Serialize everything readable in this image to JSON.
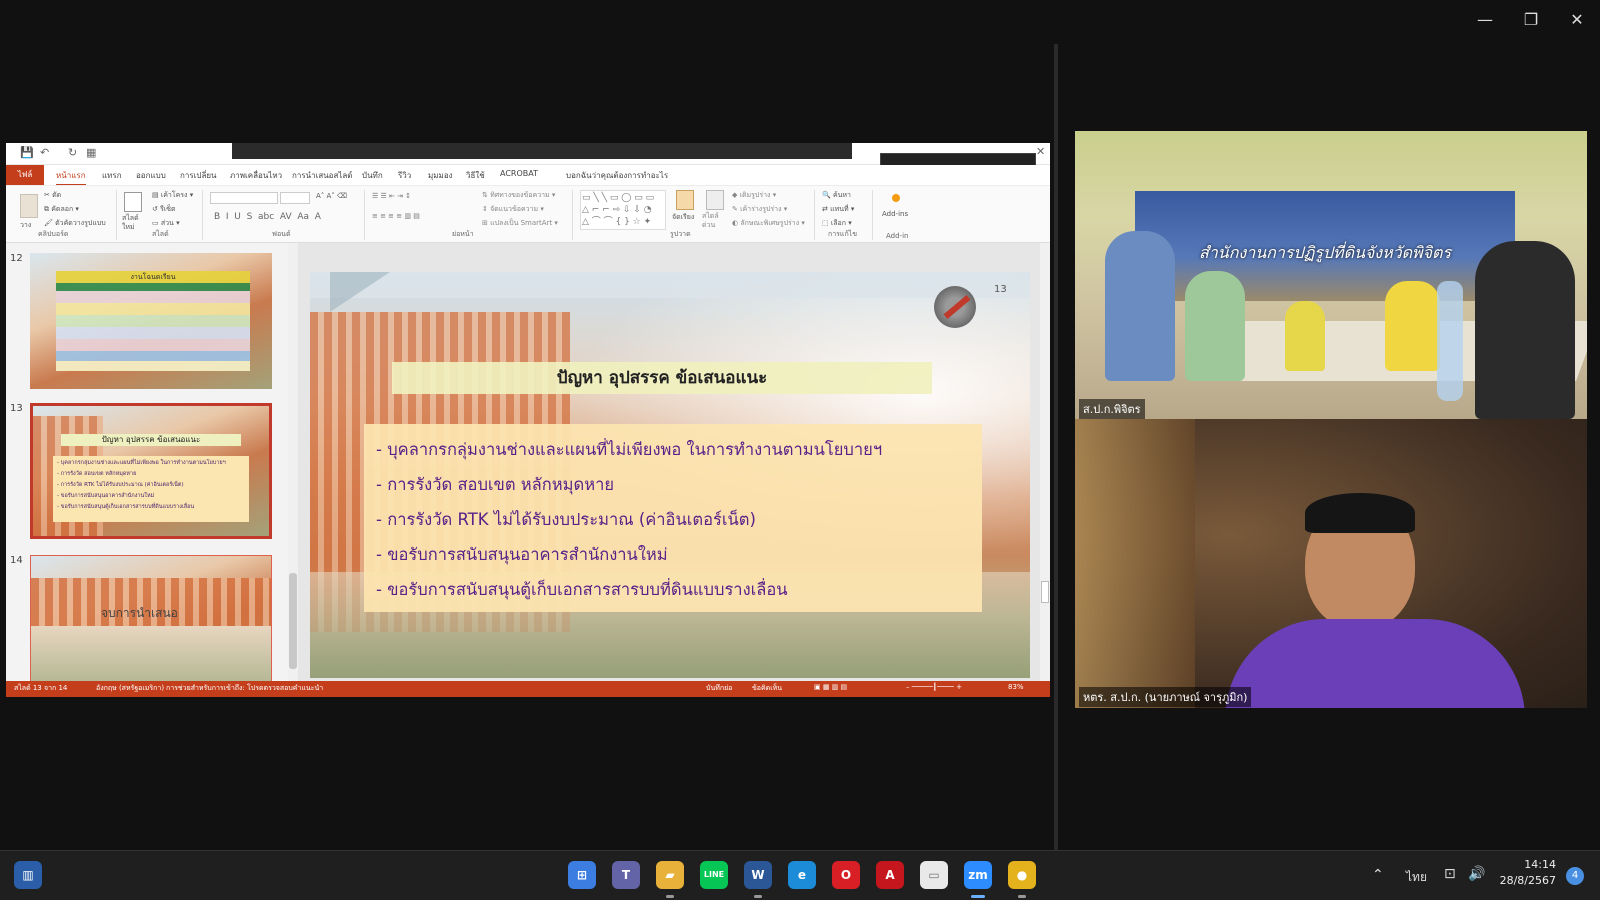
{
  "window": {
    "minimize": "—",
    "restore": "❐",
    "close": "✕"
  },
  "ppt": {
    "title_overlay": "",
    "tabs": [
      {
        "label": "ไฟล์",
        "cls": "file"
      },
      {
        "label": "หน้าแรก",
        "cls": "active"
      },
      {
        "label": "แทรก"
      },
      {
        "label": "ออกแบบ"
      },
      {
        "label": "การเปลี่ยน"
      },
      {
        "label": "ภาพเคลื่อนไหว"
      },
      {
        "label": "การนำเสนอสไลด์"
      },
      {
        "label": "บันทึก"
      },
      {
        "label": "รีวิว"
      },
      {
        "label": "มุมมอง"
      },
      {
        "label": "วิธีใช้"
      },
      {
        "label": "ACROBAT"
      },
      {
        "label": "บอกฉันว่าคุณต้องการทำอะไร"
      }
    ],
    "ribbon": {
      "clipboard": {
        "cut": "ตัด",
        "copy": "คัดลอก",
        "format_painter": "ตัวคัดวางรูปแบบ",
        "paste": "วาง",
        "group": "คลิปบอร์ด"
      },
      "slides": {
        "new_slide": "สไลด์ใหม่",
        "layout": "เค้าโครง",
        "reset": "รีเซ็ต",
        "section": "ส่วน",
        "group": "สไลด์"
      },
      "font": {
        "group": "ฟอนต์"
      },
      "paragraph": {
        "text_direction": "ทิศทางของข้อความ",
        "align_text": "จัดแนวข้อความ",
        "smartart": "แปลงเป็น SmartArt",
        "group": "ย่อหน้า"
      },
      "drawing": {
        "arrange": "จัดเรียง",
        "quick_styles": "สไตล์ด่วน",
        "shape_fill": "เติมรูปร่าง",
        "shape_outline": "เค้าร่างรูปร่าง",
        "shape_effects": "ลักษณะพิเศษรูปร่าง",
        "group": "รูปวาด"
      },
      "editing": {
        "find": "ค้นหา",
        "replace": "แทนที่",
        "select": "เลือก",
        "group": "การแก้ไข"
      },
      "addins": {
        "label": "Add-ins",
        "group": "Add-in"
      }
    },
    "thumbnails": [
      {
        "num": "12",
        "title": "งานโฉนดเรียน"
      },
      {
        "num": "13",
        "title": "ปัญหา อุปสรรค ข้อเสนอแนะ",
        "bullets": [
          "- บุคลากรกลุ่มงานช่างและแผนที่ไม่เพียงพอ ในการทำงานตามนโยบายฯ",
          "- การรังวัด สอบเขต หลักหมุดหาย",
          "- การรังวัด RTK ไม่ได้รับงบประมาณ (ค่าอินเตอร์เน็ต)",
          "- ขอรับการสนับสนุนอาคารสำนักงานใหม่",
          "- ขอรับการสนับสนุนตู้เก็บเอกสารสารบบที่ดินแบบรางเลื่อน"
        ]
      },
      {
        "num": "14",
        "title": "จบการนำเสนอ"
      }
    ],
    "slide": {
      "number": "13",
      "title": "ปัญหา อุปสรรค ข้อเสนอแนะ",
      "bullets": [
        "- บุคลากรกลุ่มงานช่างและแผนที่ไม่เพียงพอ ในการทำงานตามนโยบายฯ",
        "- การรังวัด สอบเขต หลักหมุดหาย",
        "- การรังวัด RTK ไม่ได้รับงบประมาณ (ค่าอินเตอร์เน็ต)",
        "- ขอรับการสนับสนุนอาคารสำนักงานใหม่",
        "- ขอรับการสนับสนุนตู้เก็บเอกสารสารบบที่ดินแบบรางเลื่อน"
      ]
    },
    "status": {
      "slide_count": "สไลด์ 13 จาก 14",
      "language": "อังกฤษ (สหรัฐอเมริกา)",
      "accessibility": "การช่วยสำหรับการเข้าถึง: โปรดตรวจสอบคำแนะนำ",
      "notes": "บันทึกย่อ",
      "comments": "ข้อคิดเห็น",
      "zoom": "83%"
    }
  },
  "video": {
    "tile1_name": "ส.ป.ก.พิจิตร",
    "banner": "สำนักงานการปฏิรูปที่ดินจังหวัดพิจิตร",
    "tile2_name": "หตร. ส.ป.ก. (นายภาษณ์ จารุภูมิก)"
  },
  "taskbar": {
    "apps": [
      {
        "name": "start-button",
        "label": "⊞",
        "color": "#3b7de0"
      },
      {
        "name": "teams-icon",
        "label": "T",
        "color": "#6264a7"
      },
      {
        "name": "file-explorer-icon",
        "label": "▰",
        "color": "#e8b23a"
      },
      {
        "name": "line-icon",
        "label": "LINE",
        "color": "#06c755"
      },
      {
        "name": "word-icon",
        "label": "W",
        "color": "#2b5797"
      },
      {
        "name": "edge-icon",
        "label": "e",
        "color": "#1c8bd8"
      },
      {
        "name": "opera-icon",
        "label": "O",
        "color": "#d81f26"
      },
      {
        "name": "acrobat-icon",
        "label": "A",
        "color": "#c4161c"
      },
      {
        "name": "notepad-icon",
        "label": "▭",
        "color": "#e9e9e9"
      },
      {
        "name": "zoom-icon",
        "label": "zm",
        "color": "#2d8cff"
      },
      {
        "name": "chrome-icon",
        "label": "●",
        "color": "#e3b21c"
      }
    ],
    "language": "ไทย",
    "time": "14:14",
    "date": "28/8/2567",
    "notifications": "4"
  }
}
